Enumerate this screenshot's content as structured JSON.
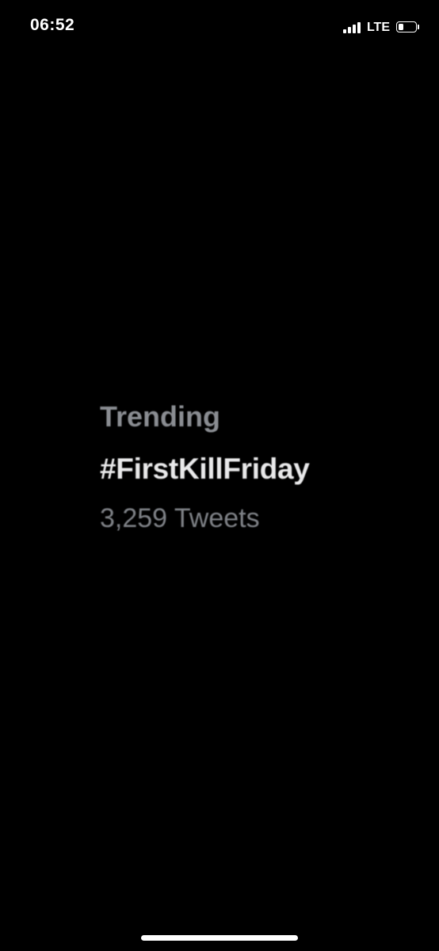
{
  "status_bar": {
    "time": "06:52",
    "network": "LTE",
    "signal_icon": "signal-bars-icon",
    "battery_icon": "battery-icon",
    "battery_level": 0.3
  },
  "trend": {
    "label": "Trending",
    "hashtag": "#FirstKillFriday",
    "count": "3,259 Tweets"
  }
}
